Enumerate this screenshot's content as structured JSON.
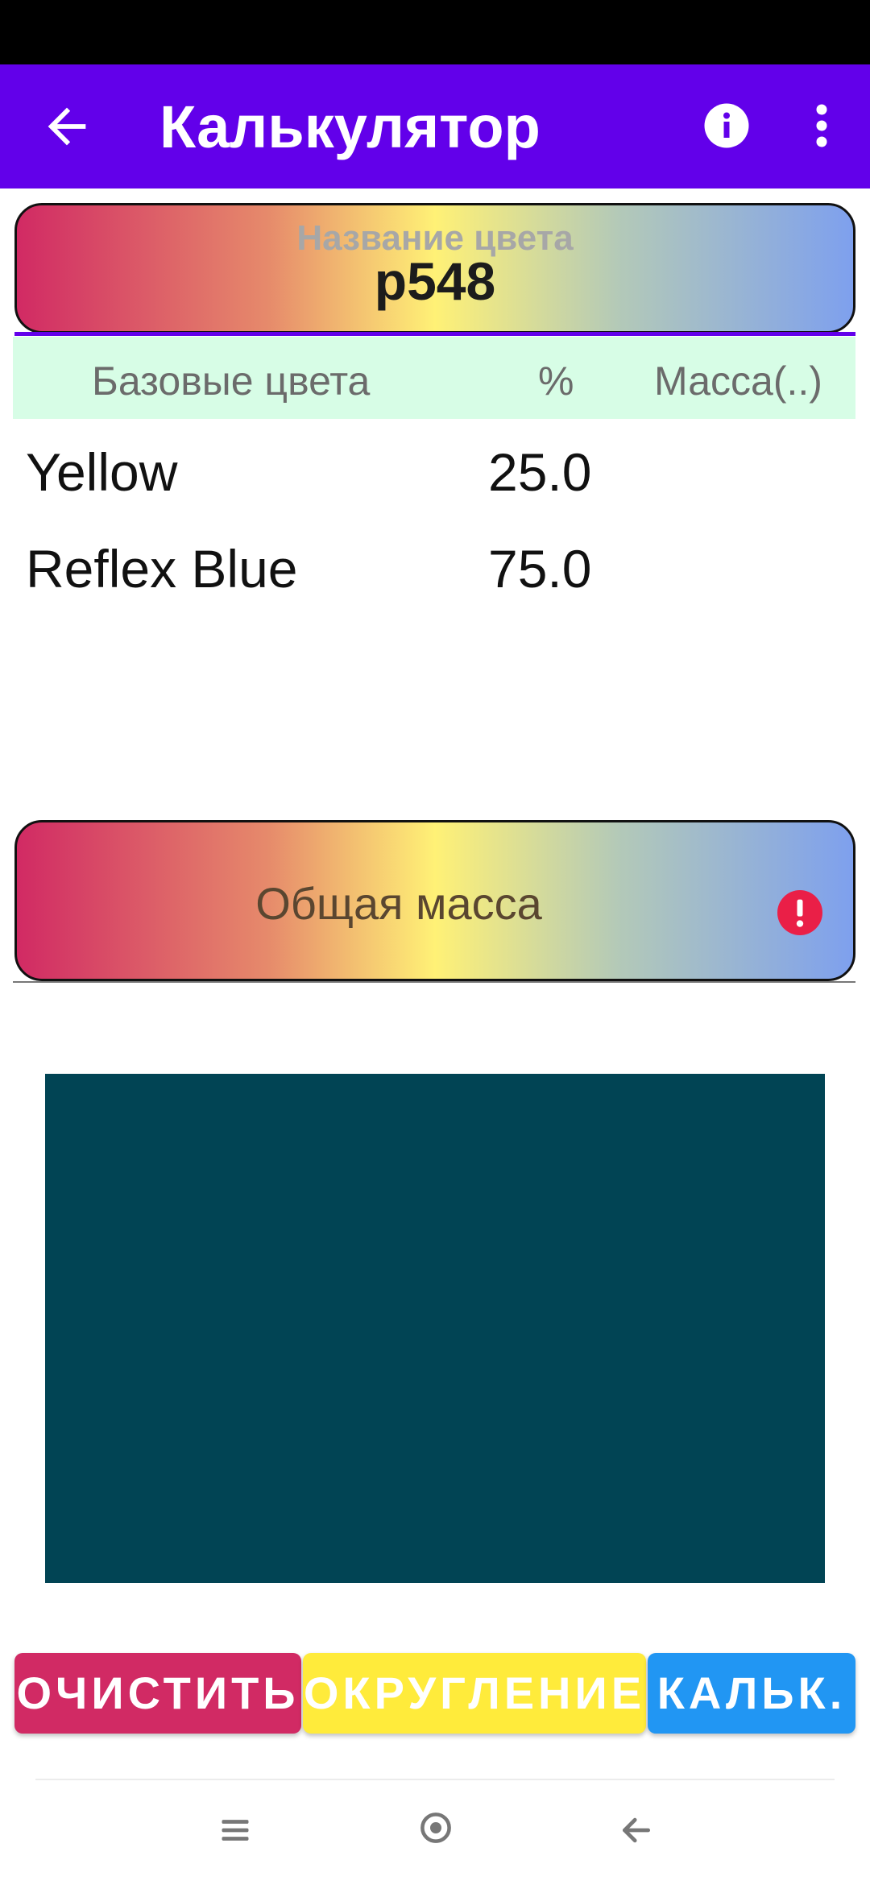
{
  "app_bar": {
    "title": "Калькулятор",
    "back_icon": "arrow-left-icon",
    "info_icon": "info-icon",
    "more_icon": "more-vertical-icon",
    "color": "#6200ea"
  },
  "color_name": {
    "label": "Название цвета",
    "value": "p548"
  },
  "table": {
    "headers": [
      "Базовые цвета",
      "%",
      "Масса(..)"
    ],
    "rows": [
      {
        "name": "Yellow",
        "percent": "25.0",
        "mass": ""
      },
      {
        "name": "Reflex Blue",
        "percent": "75.0",
        "mass": ""
      }
    ]
  },
  "total_mass": {
    "placeholder": "Общая масса",
    "error_icon": "error-icon",
    "error_color": "#ea1f47"
  },
  "swatch": {
    "color": "#014454"
  },
  "buttons": {
    "clear": "ОЧИСТИТЬ",
    "round": "ОКРУГЛЕНИЕ",
    "calc": "КАЛЬК."
  },
  "colors": {
    "clear": "#d12a64",
    "round": "#ffeb3b",
    "calc": "#2196f3",
    "header_bg": "#d7fde6"
  },
  "system_nav": {
    "menu_icon": "menu-icon",
    "home_icon": "home-icon",
    "back_icon": "back-arrow-icon"
  }
}
